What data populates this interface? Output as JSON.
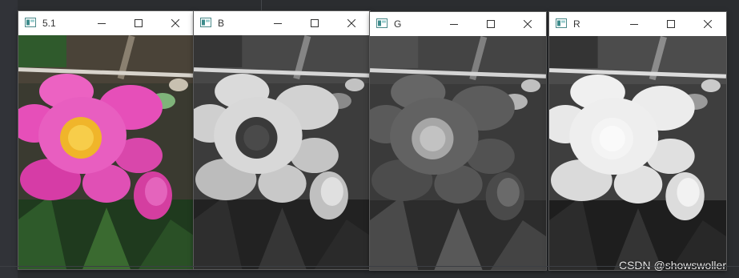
{
  "windows": [
    {
      "title": "5.1",
      "channel": "original"
    },
    {
      "title": "B",
      "channel": "blue"
    },
    {
      "title": "G",
      "channel": "green"
    },
    {
      "title": "R",
      "channel": "red"
    }
  ],
  "icons": {
    "app": "opencv-window-icon",
    "minimize": "minimize-icon",
    "maximize": "maximize-icon",
    "close": "close-icon"
  },
  "colors": {
    "petal_original": "#e64fb9",
    "center_original": "#f0b52a",
    "petal_B": "#d2d2d2",
    "center_B": "#3a3a3a",
    "petal_G": "#5c5c5c",
    "center_G": "#a6a6a6",
    "petal_R": "#ececec",
    "center_R": "#f4f4f4"
  },
  "watermark": "CSDN @showswoller"
}
